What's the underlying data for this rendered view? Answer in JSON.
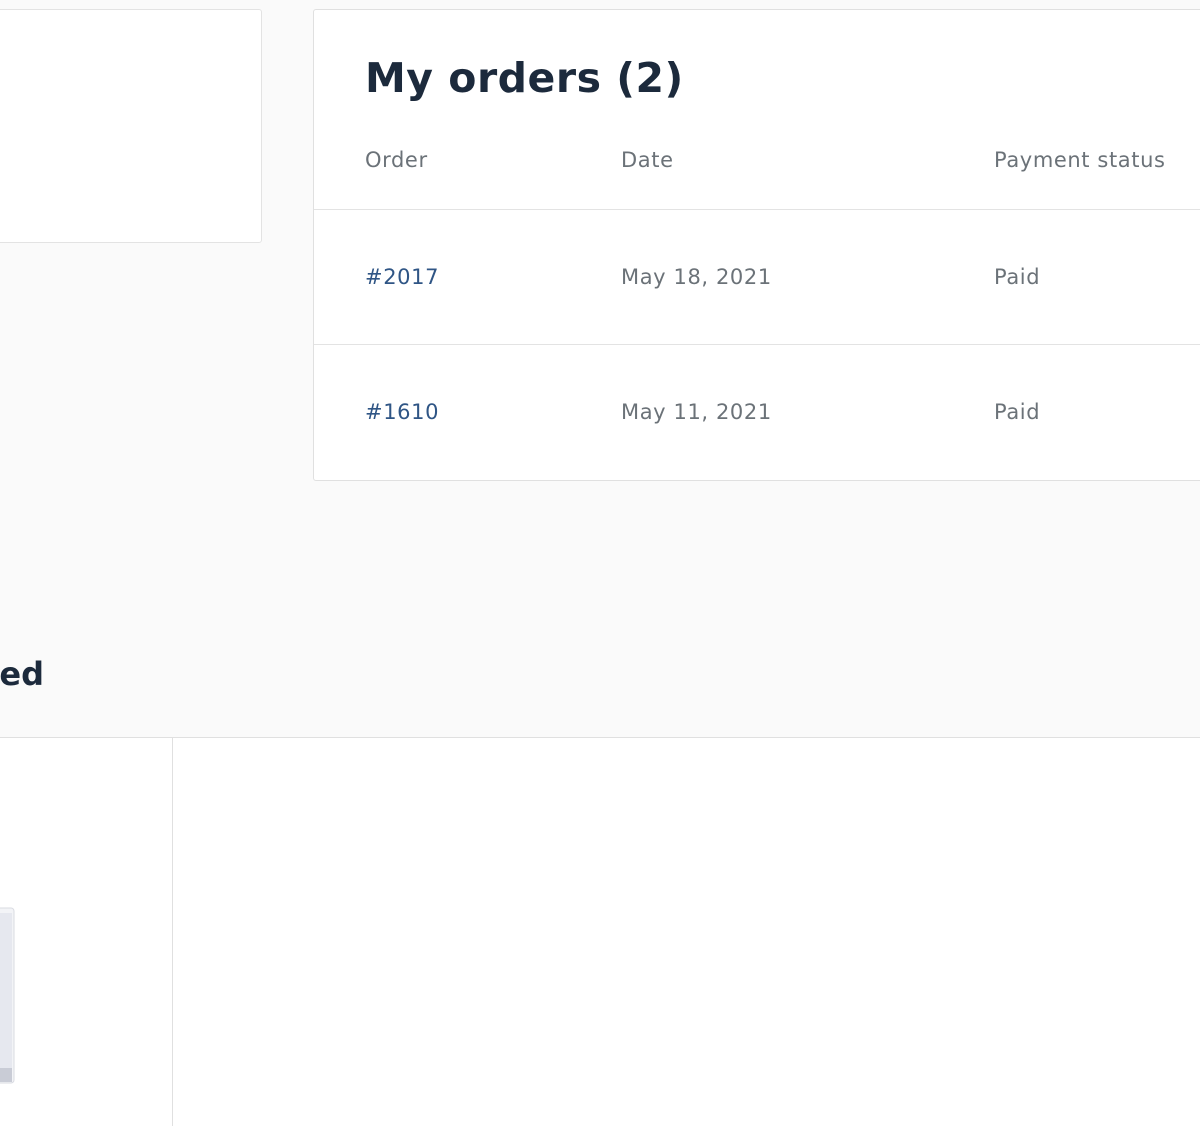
{
  "orders": {
    "title": "My orders (2)",
    "columns": {
      "order": "Order",
      "date": "Date",
      "payment_status": "Payment status"
    },
    "rows": [
      {
        "order": "#2017",
        "date": "May 18, 2021",
        "payment_status": "Paid"
      },
      {
        "order": "#1610",
        "date": "May 11, 2021",
        "payment_status": "Paid"
      }
    ]
  },
  "section": {
    "heading_fragment": "ed"
  },
  "colors": {
    "background": "#fafafa",
    "card": "#ffffff",
    "heading": "#1c2a3c",
    "muted_text": "#6b7278",
    "link": "#2f5585",
    "border": "#e3e3e3"
  }
}
